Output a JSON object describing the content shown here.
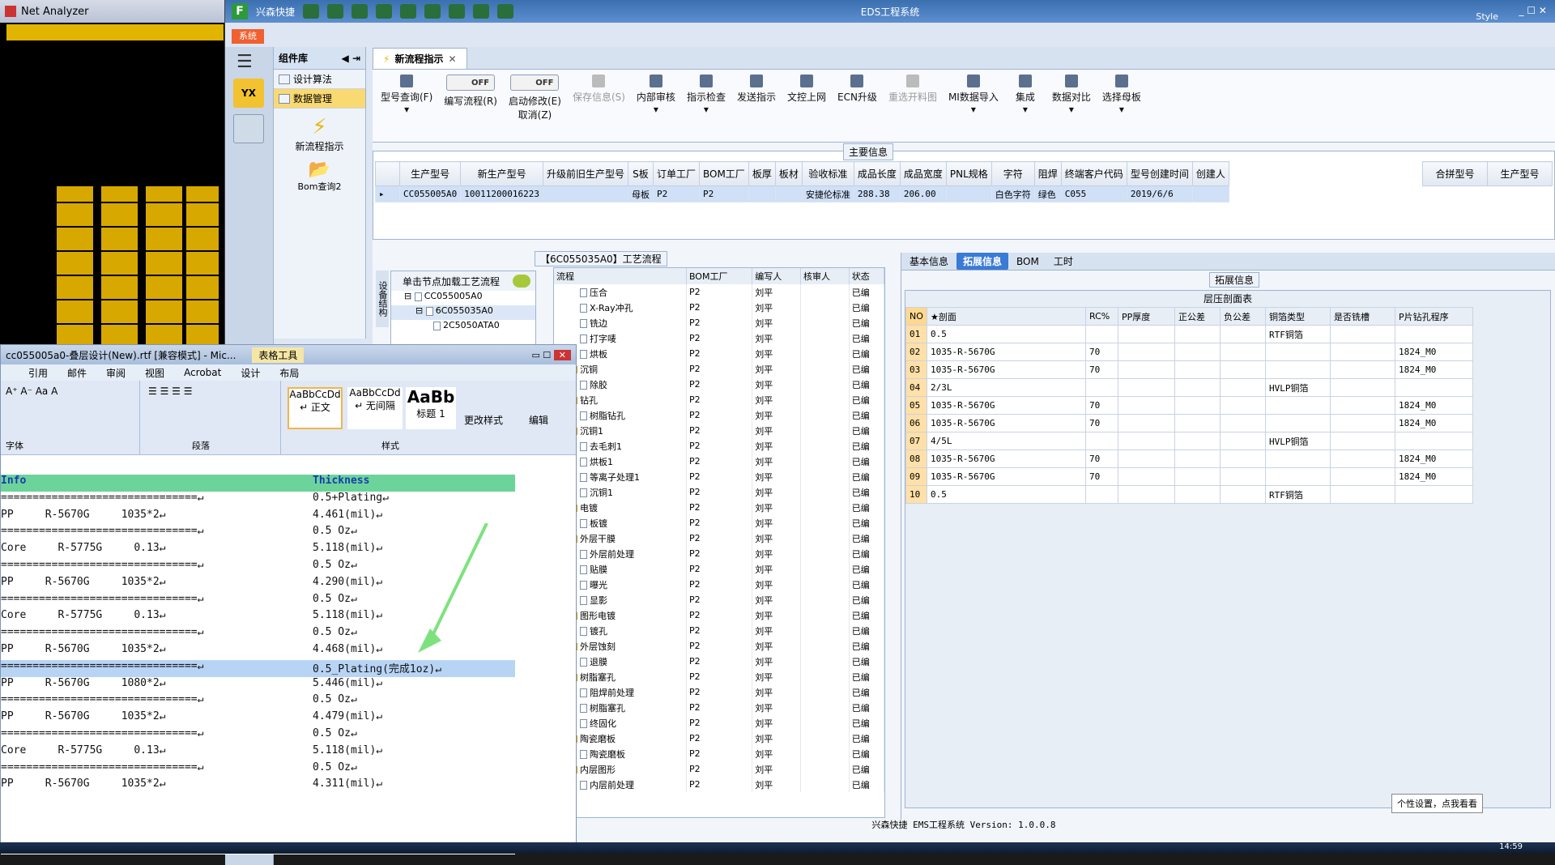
{
  "net_analyzer": {
    "title": "Net Analyzer"
  },
  "eds": {
    "title": "EDS工程系统",
    "app_name": "兴森快捷",
    "sys_tab": "系统",
    "style_label": "Style",
    "component_lib": "组件库",
    "lib_items": [
      "设计算法",
      "数据管理"
    ],
    "lib_tools": [
      "新流程指示",
      "Bom查询2"
    ],
    "main_tab": "新流程指示",
    "ribbon": {
      "query": "型号查询(F)",
      "edit_flow": "编写流程(R)",
      "start_modify": "启动修改(E)",
      "cancel": "取消(Z)",
      "toggle_off": "OFF",
      "buttons": [
        "保存信息(S)",
        "内部审核",
        "指示检查",
        "发送指示",
        "文控上网",
        "ECN升级",
        "重选开料图",
        "MI数据导入",
        "集成",
        "数据对比",
        "选择母板"
      ]
    },
    "main_info": {
      "title": "主要信息",
      "headers": [
        "生产型号",
        "新生产型号",
        "升级前旧生产型号",
        "S板",
        "订单工厂",
        "BOM工厂",
        "板厚",
        "板材",
        "验收标准",
        "成品长度",
        "成品宽度",
        "PNL规格",
        "字符",
        "阻焊",
        "终端客户代码",
        "型号创建时间",
        "创建人"
      ],
      "row": [
        "CC055005A0",
        "10011200016223",
        "",
        "母板",
        "P2",
        "P2",
        "",
        "",
        "安捷伦标准",
        "288.38",
        "206.00",
        "",
        "白色字符",
        "绿色",
        "C055",
        "2019/6/6",
        ""
      ],
      "side_headers": [
        "合拼型号",
        "生产型号"
      ]
    },
    "process": {
      "title": "【6C055035A0】工艺流程",
      "left_tab": "设备结构",
      "load_hint": "单击节点加载工艺流程",
      "tree": [
        "CC055005A0",
        "6C055035A0",
        "2C5050ATA0"
      ],
      "headers": [
        "流程",
        "BOM工厂",
        "编写人",
        "核审人",
        "状态"
      ],
      "rows": [
        {
          "name": "压合",
          "indent": 2,
          "type": "doc",
          "f": "P2",
          "w": "刘平",
          "s": "已编"
        },
        {
          "name": "X-Ray冲孔",
          "indent": 2,
          "type": "doc",
          "f": "P2",
          "w": "刘平",
          "s": "已编"
        },
        {
          "name": "铣边",
          "indent": 2,
          "type": "doc",
          "f": "P2",
          "w": "刘平",
          "s": "已编"
        },
        {
          "name": "打字唛",
          "indent": 2,
          "type": "doc",
          "f": "P2",
          "w": "刘平",
          "s": "已编"
        },
        {
          "name": "烘板",
          "indent": 2,
          "type": "doc",
          "f": "P2",
          "w": "刘平",
          "s": "已编"
        },
        {
          "name": "沉铜",
          "indent": 1,
          "type": "fold",
          "f": "P2",
          "w": "刘平",
          "s": "已编"
        },
        {
          "name": "除胶",
          "indent": 2,
          "type": "doc",
          "f": "P2",
          "w": "刘平",
          "s": "已编"
        },
        {
          "name": "钻孔",
          "indent": 1,
          "type": "fold",
          "f": "P2",
          "w": "刘平",
          "s": "已编"
        },
        {
          "name": "树脂钻孔",
          "indent": 2,
          "type": "doc",
          "f": "P2",
          "w": "刘平",
          "s": "已编"
        },
        {
          "name": "沉铜1",
          "indent": 1,
          "type": "fold",
          "f": "P2",
          "w": "刘平",
          "s": "已编"
        },
        {
          "name": "去毛刺1",
          "indent": 2,
          "type": "doc",
          "f": "P2",
          "w": "刘平",
          "s": "已编"
        },
        {
          "name": "烘板1",
          "indent": 2,
          "type": "doc",
          "f": "P2",
          "w": "刘平",
          "s": "已编"
        },
        {
          "name": "等离子处理1",
          "indent": 2,
          "type": "doc",
          "f": "P2",
          "w": "刘平",
          "s": "已编"
        },
        {
          "name": "沉铜1",
          "indent": 2,
          "type": "doc",
          "f": "P2",
          "w": "刘平",
          "s": "已编"
        },
        {
          "name": "电镀",
          "indent": 1,
          "type": "fold",
          "f": "P2",
          "w": "刘平",
          "s": "已编"
        },
        {
          "name": "板镀",
          "indent": 2,
          "type": "doc",
          "f": "P2",
          "w": "刘平",
          "s": "已编"
        },
        {
          "name": "外层干膜",
          "indent": 1,
          "type": "fold",
          "f": "P2",
          "w": "刘平",
          "s": "已编"
        },
        {
          "name": "外层前处理",
          "indent": 2,
          "type": "doc",
          "f": "P2",
          "w": "刘平",
          "s": "已编"
        },
        {
          "name": "贴膜",
          "indent": 2,
          "type": "doc",
          "f": "P2",
          "w": "刘平",
          "s": "已编"
        },
        {
          "name": "曝光",
          "indent": 2,
          "type": "doc",
          "f": "P2",
          "w": "刘平",
          "s": "已编"
        },
        {
          "name": "显影",
          "indent": 2,
          "type": "doc",
          "f": "P2",
          "w": "刘平",
          "s": "已编"
        },
        {
          "name": "图形电镀",
          "indent": 1,
          "type": "fold",
          "f": "P2",
          "w": "刘平",
          "s": "已编"
        },
        {
          "name": "镀孔",
          "indent": 2,
          "type": "doc",
          "f": "P2",
          "w": "刘平",
          "s": "已编"
        },
        {
          "name": "外层蚀刻",
          "indent": 1,
          "type": "fold",
          "f": "P2",
          "w": "刘平",
          "s": "已编"
        },
        {
          "name": "退膜",
          "indent": 2,
          "type": "doc",
          "f": "P2",
          "w": "刘平",
          "s": "已编"
        },
        {
          "name": "树脂塞孔",
          "indent": 1,
          "type": "fold",
          "f": "P2",
          "w": "刘平",
          "s": "已编"
        },
        {
          "name": "阻焊前处理",
          "indent": 2,
          "type": "doc",
          "f": "P2",
          "w": "刘平",
          "s": "已编"
        },
        {
          "name": "树脂塞孔",
          "indent": 2,
          "type": "doc",
          "f": "P2",
          "w": "刘平",
          "s": "已编"
        },
        {
          "name": "终固化",
          "indent": 2,
          "type": "doc",
          "f": "P2",
          "w": "刘平",
          "s": "已编"
        },
        {
          "name": "陶瓷磨板",
          "indent": 1,
          "type": "fold",
          "f": "P2",
          "w": "刘平",
          "s": "已编"
        },
        {
          "name": "陶瓷磨板",
          "indent": 2,
          "type": "doc",
          "f": "P2",
          "w": "刘平",
          "s": "已编"
        },
        {
          "name": "内层图形",
          "indent": 1,
          "type": "fold",
          "f": "P2",
          "w": "刘平",
          "s": "已编"
        },
        {
          "name": "内层前处理",
          "indent": 2,
          "type": "doc",
          "f": "P2",
          "w": "刘平",
          "s": "已编"
        }
      ]
    },
    "right": {
      "tabs": [
        "基本信息",
        "拓展信息",
        "BOM",
        "工时"
      ],
      "section": "拓展信息",
      "table_title": "层压剖面表",
      "headers": [
        "NO",
        "★剖面",
        "RC%",
        "PP厚度",
        "正公差",
        "负公差",
        "铜箔类型",
        "是否铣槽",
        "P片钻孔程序"
      ],
      "rows": [
        [
          "01",
          "0.5",
          "",
          "",
          "",
          "",
          "RTF铜箔",
          "",
          ""
        ],
        [
          "02",
          "1035-R-5670G",
          "70",
          "",
          "",
          "",
          "",
          "",
          "1824_M0"
        ],
        [
          "03",
          "1035-R-5670G",
          "70",
          "",
          "",
          "",
          "",
          "",
          "1824_M0"
        ],
        [
          "04",
          "2/3L",
          "",
          "",
          "",
          "",
          "HVLP铜箔",
          "",
          ""
        ],
        [
          "05",
          "1035-R-5670G",
          "70",
          "",
          "",
          "",
          "",
          "",
          "1824_M0"
        ],
        [
          "06",
          "1035-R-5670G",
          "70",
          "",
          "",
          "",
          "",
          "",
          "1824_M0"
        ],
        [
          "07",
          "4/5L",
          "",
          "",
          "",
          "",
          "HVLP铜箔",
          "",
          ""
        ],
        [
          "08",
          "1035-R-5670G",
          "70",
          "",
          "",
          "",
          "",
          "",
          "1824_M0"
        ],
        [
          "09",
          "1035-R-5670G",
          "70",
          "",
          "",
          "",
          "",
          "",
          "1824_M0"
        ],
        [
          "10",
          "0.5",
          "",
          "",
          "",
          "",
          "RTF铜箔",
          "",
          ""
        ]
      ]
    },
    "status": "兴森快捷 EMS工程系统 Version: 1.0.0.8",
    "tooltip": "个性设置，点我看看",
    "clock": "14:59"
  },
  "word": {
    "title": "cc055005a0-叠层设计(New).rtf [兼容模式] - Mic...",
    "context_tab": "表格工具",
    "menu": [
      "引用",
      "邮件",
      "审阅",
      "视图",
      "Acrobat",
      "设计",
      "布局"
    ],
    "groups": [
      "字体",
      "段落",
      "样式"
    ],
    "styles": [
      {
        "sample": "AaBbCcDd",
        "name": "↵ 正文"
      },
      {
        "sample": "AaBbCcDd",
        "name": "↵ 无间隔"
      },
      {
        "sample": "AaBb",
        "name": "标题 1"
      }
    ],
    "change_style": "更改样式",
    "edit": "编辑",
    "doc": {
      "header": [
        "Info",
        "Thickness"
      ],
      "rows": [
        [
          "===============================↵",
          "0.5+Plating↵"
        ],
        [
          "PP     R-5670G     1035*2↵",
          "4.461(mil)↵"
        ],
        [
          "===============================↵",
          "0.5 Oz↵"
        ],
        [
          "Core     R-5775G     0.13↵",
          "5.118(mil)↵"
        ],
        [
          "===============================↵",
          "0.5 Oz↵"
        ],
        [
          "PP     R-5670G     1035*2↵",
          "4.290(mil)↵"
        ],
        [
          "===============================↵",
          "0.5 Oz↵"
        ],
        [
          "Core     R-5775G     0.13↵",
          "5.118(mil)↵"
        ],
        [
          "===============================↵",
          "0.5 Oz↵"
        ],
        [
          "PP     R-5670G     1035*2↵",
          "4.468(mil)↵"
        ],
        [
          "===============================↵",
          "0.5_Plating(完成1oz)↵"
        ],
        [
          "PP     R-5670G     1080*2↵",
          "5.446(mil)↵"
        ],
        [
          "===============================↵",
          "0.5 Oz↵"
        ],
        [
          "PP     R-5670G     1035*2↵",
          "4.479(mil)↵"
        ],
        [
          "===============================↵",
          "0.5 Oz↵"
        ],
        [
          "Core     R-5775G     0.13↵",
          "5.118(mil)↵"
        ],
        [
          "===============================↵",
          "0.5 Oz↵"
        ],
        [
          "PP     R-5670G     1035*2↵",
          "4.311(mil)↵"
        ]
      ],
      "highlight_row": 10
    }
  }
}
